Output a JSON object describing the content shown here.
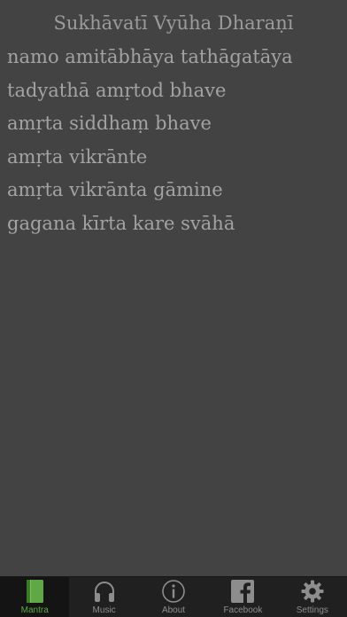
{
  "mantra": {
    "title": "Sukhāvatī Vyūha Dharaṇī",
    "lines": [
      "namo amitābhāya tathāgatāya",
      "tadyathā amṛtod bhave",
      "amṛta siddhaṃ bhave",
      "amṛta vikrānte",
      "amṛta vikrānta gāmine",
      "gagana kīrta kare svāhā"
    ]
  },
  "tabbar": {
    "active_color": "#5fa845",
    "inactive_color": "#8d8d8d",
    "tabs": [
      {
        "label": "Mantra",
        "icon": "book-icon",
        "active": true
      },
      {
        "label": "Music",
        "icon": "headphones-icon",
        "active": false
      },
      {
        "label": "About",
        "icon": "info-icon",
        "active": false
      },
      {
        "label": "Facebook",
        "icon": "facebook-icon",
        "active": false
      },
      {
        "label": "Settings",
        "icon": "gear-icon",
        "active": false
      }
    ]
  }
}
